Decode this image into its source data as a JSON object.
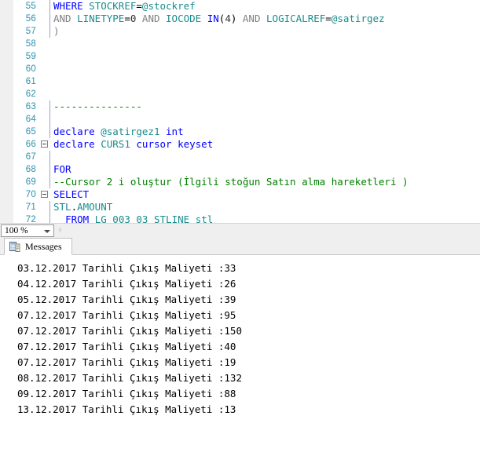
{
  "editor": {
    "lines": [
      {
        "num": "55",
        "fold": false,
        "guide": true,
        "tokens": [
          {
            "t": "WHERE",
            "c": "kw"
          },
          {
            "t": " ",
            "c": "plain"
          },
          {
            "t": "STOCKREF",
            "c": "id"
          },
          {
            "t": "=",
            "c": "plain"
          },
          {
            "t": "@stockref",
            "c": "id"
          }
        ]
      },
      {
        "num": "56",
        "fold": false,
        "guide": true,
        "tokens": [
          {
            "t": "AND",
            "c": "gray"
          },
          {
            "t": " ",
            "c": "plain"
          },
          {
            "t": "LINETYPE",
            "c": "id"
          },
          {
            "t": "=",
            "c": "plain"
          },
          {
            "t": "0",
            "c": "num"
          },
          {
            "t": " ",
            "c": "plain"
          },
          {
            "t": "AND",
            "c": "gray"
          },
          {
            "t": " ",
            "c": "plain"
          },
          {
            "t": "IOCODE",
            "c": "id"
          },
          {
            "t": " ",
            "c": "plain"
          },
          {
            "t": "IN",
            "c": "kw"
          },
          {
            "t": "(",
            "c": "plain"
          },
          {
            "t": "4",
            "c": "num"
          },
          {
            "t": ")",
            "c": "plain"
          },
          {
            "t": " ",
            "c": "plain"
          },
          {
            "t": "AND",
            "c": "gray"
          },
          {
            "t": " ",
            "c": "plain"
          },
          {
            "t": "LOGICALREF",
            "c": "id"
          },
          {
            "t": "=",
            "c": "plain"
          },
          {
            "t": "@satirgez",
            "c": "id"
          }
        ]
      },
      {
        "num": "57",
        "fold": false,
        "guide": true,
        "tokens": [
          {
            "t": ")",
            "c": "gray"
          }
        ]
      },
      {
        "num": "58",
        "fold": false,
        "guide": false,
        "tokens": []
      },
      {
        "num": "59",
        "fold": false,
        "guide": false,
        "tokens": []
      },
      {
        "num": "60",
        "fold": false,
        "guide": false,
        "tokens": []
      },
      {
        "num": "61",
        "fold": false,
        "guide": false,
        "tokens": []
      },
      {
        "num": "62",
        "fold": false,
        "guide": false,
        "tokens": []
      },
      {
        "num": "63",
        "fold": false,
        "guide": true,
        "tokens": [
          {
            "t": "---------------",
            "c": "cmt"
          }
        ]
      },
      {
        "num": "64",
        "fold": false,
        "guide": true,
        "tokens": []
      },
      {
        "num": "65",
        "fold": false,
        "guide": true,
        "tokens": [
          {
            "t": "declare",
            "c": "kw"
          },
          {
            "t": " ",
            "c": "plain"
          },
          {
            "t": "@satirgez1",
            "c": "id"
          },
          {
            "t": " ",
            "c": "plain"
          },
          {
            "t": "int",
            "c": "kw"
          }
        ]
      },
      {
        "num": "66",
        "fold": true,
        "guide": false,
        "tokens": [
          {
            "t": "declare",
            "c": "kw"
          },
          {
            "t": " ",
            "c": "plain"
          },
          {
            "t": "CURS1",
            "c": "id"
          },
          {
            "t": " ",
            "c": "plain"
          },
          {
            "t": "cursor",
            "c": "kw"
          },
          {
            "t": " ",
            "c": "plain"
          },
          {
            "t": "keyset",
            "c": "kw"
          }
        ]
      },
      {
        "num": "67",
        "fold": false,
        "guide": true,
        "tokens": []
      },
      {
        "num": "68",
        "fold": false,
        "guide": true,
        "tokens": [
          {
            "t": "FOR",
            "c": "kw"
          }
        ]
      },
      {
        "num": "69",
        "fold": false,
        "guide": true,
        "tokens": [
          {
            "t": "--Cursor 2 i oluştur (İlgili stoğun Satın alma hareketleri )",
            "c": "cmt"
          }
        ]
      },
      {
        "num": "70",
        "fold": true,
        "guide": false,
        "tokens": [
          {
            "t": "SELECT",
            "c": "kw"
          }
        ]
      },
      {
        "num": "71",
        "fold": false,
        "guide": true,
        "tokens": [
          {
            "t": "STL",
            "c": "id"
          },
          {
            "t": ".",
            "c": "plain"
          },
          {
            "t": "AMOUNT",
            "c": "id"
          }
        ]
      },
      {
        "num": "72",
        "fold": false,
        "guide": true,
        "tokens": [
          {
            "t": "  ",
            "c": "plain"
          },
          {
            "t": "FROM",
            "c": "kw"
          },
          {
            "t": " ",
            "c": "plain"
          },
          {
            "t": "LG",
            "c": "id"
          },
          {
            "t": " ",
            "c": "plain"
          },
          {
            "t": "003",
            "c": "id"
          },
          {
            "t": " ",
            "c": "plain"
          },
          {
            "t": "03",
            "c": "id"
          },
          {
            "t": " ",
            "c": "plain"
          },
          {
            "t": "STLINE",
            "c": "id"
          },
          {
            "t": " ",
            "c": "plain"
          },
          {
            "t": "stl",
            "c": "id"
          }
        ]
      }
    ]
  },
  "statusbar": {
    "zoom_value": "100 %"
  },
  "results": {
    "tab_label": "Messages",
    "messages": [
      "03.12.2017 Tarihli Çıkış Maliyeti :33",
      "04.12.2017 Tarihli Çıkış Maliyeti :26",
      "05.12.2017 Tarihli Çıkış Maliyeti :39",
      "07.12.2017 Tarihli Çıkış Maliyeti :95",
      "07.12.2017 Tarihli Çıkış Maliyeti :150",
      "07.12.2017 Tarihli Çıkış Maliyeti :40",
      "07.12.2017 Tarihli Çıkış Maliyeti :19",
      "08.12.2017 Tarihli Çıkış Maliyeti :132",
      "09.12.2017 Tarihli Çıkış Maliyeti :88",
      "13.12.2017 Tarihli Çıkış Maliyeti :13"
    ]
  },
  "colors": {
    "keyword": "#0000ff",
    "identifier": "#1a8c8c",
    "comment": "#008000",
    "linenumber": "#2b91af",
    "operator": "#808080"
  }
}
